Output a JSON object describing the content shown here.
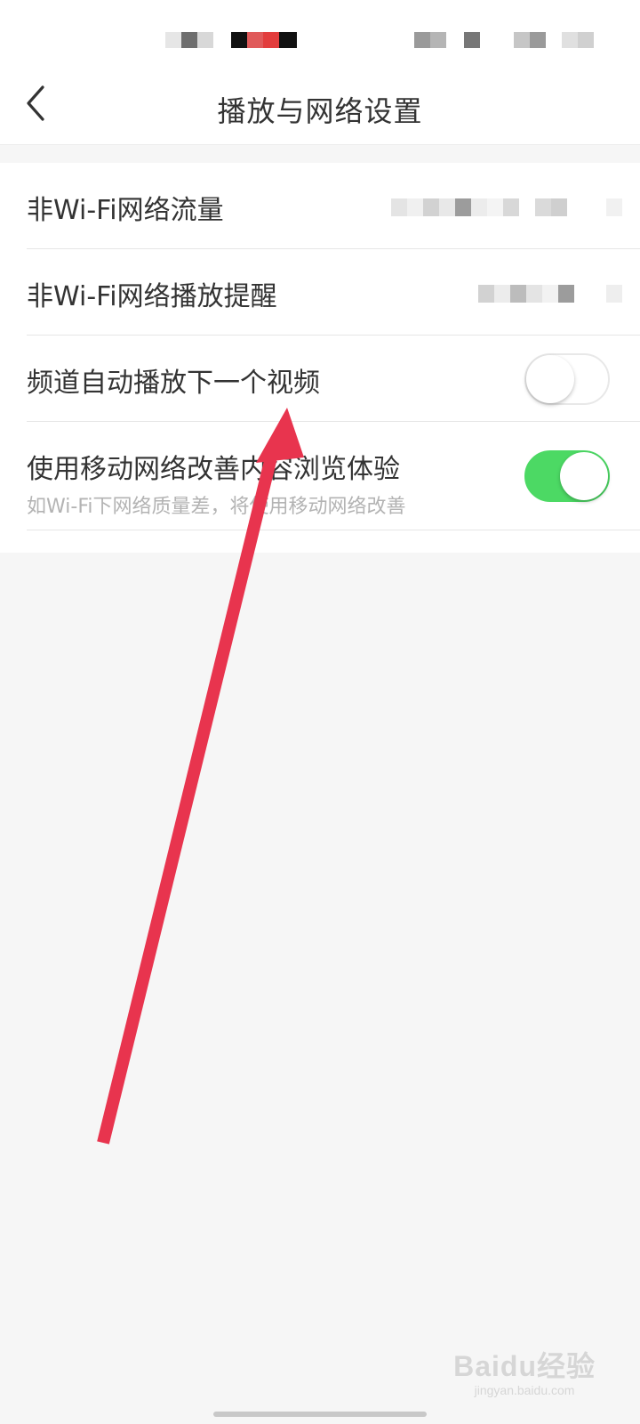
{
  "header": {
    "title": "播放与网络设置",
    "back_icon": "chevron-left-icon"
  },
  "settings": [
    {
      "label": "非Wi-Fi网络流量",
      "control": "value",
      "value_obscured": true
    },
    {
      "label": "非Wi-Fi网络播放提醒",
      "control": "value",
      "value_obscured": true
    },
    {
      "label": "频道自动播放下一个视频",
      "control": "toggle",
      "enabled": false
    },
    {
      "label": "使用移动网络改善内容浏览体验",
      "sublabel": "如Wi-Fi下网络质量差，将使用移动网络改善",
      "control": "toggle",
      "enabled": true
    }
  ],
  "watermark": {
    "logo": "Baidu经验",
    "url": "jingyan.baidu.com"
  },
  "colors": {
    "toggle_on": "#4cd964",
    "annotation_arrow": "#e8344e",
    "background": "#f6f6f6"
  }
}
